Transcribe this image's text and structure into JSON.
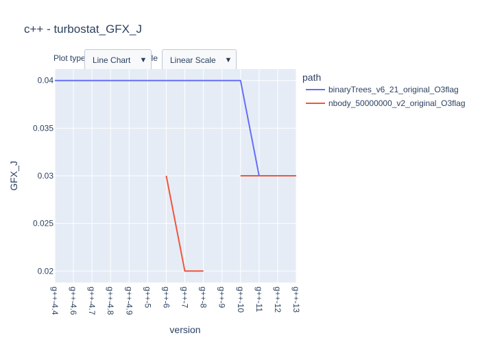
{
  "controls": {
    "plot_type_label": "Plot type",
    "scale_label": "Scale",
    "plot_type_value": "Line Chart",
    "scale_value": "Linear Scale",
    "arrow": "▼"
  },
  "chart_data": {
    "type": "line",
    "title": "c++ - turbostat_GFX_J",
    "xlabel": "version",
    "ylabel": "GFX_J",
    "legend_title": "path",
    "legend_position": "right",
    "categories": [
      "g++-4.4",
      "g++-4.6",
      "g++-4.7",
      "g++-4.8",
      "g++-4.9",
      "g++-5",
      "g++-6",
      "g++-7",
      "g++-8",
      "g++-9",
      "g++-10",
      "g++-11",
      "g++-12",
      "g++-13"
    ],
    "ylim": [
      0.0188,
      0.0412
    ],
    "yticks": [
      0.02,
      0.025,
      0.03,
      0.035,
      0.04
    ],
    "ytick_labels": [
      "0.02",
      "0.025",
      "0.03",
      "0.035",
      "0.04"
    ],
    "grid": true,
    "series": [
      {
        "name": "binaryTrees_v6_21_original_O3flag",
        "color": "#636efa",
        "values": [
          0.04,
          0.04,
          0.04,
          0.04,
          0.04,
          0.04,
          0.04,
          0.04,
          0.04,
          0.04,
          0.04,
          0.03,
          0.03,
          0.03
        ]
      },
      {
        "name": "nbody_50000000_v2_original_O3flag",
        "color": "#ef553b",
        "values": [
          null,
          null,
          null,
          null,
          null,
          null,
          0.03,
          0.02,
          0.02,
          null,
          0.03,
          0.03,
          0.03,
          0.03
        ]
      }
    ]
  }
}
